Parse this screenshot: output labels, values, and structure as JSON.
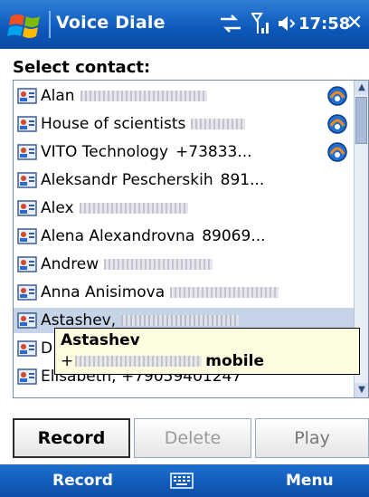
{
  "titlebar": {
    "title": "Voice Diale",
    "clock": "17:58",
    "close_glyph": "✕",
    "icons": [
      "windows-start-icon",
      "sync-icon",
      "signal-icon",
      "volume-icon"
    ]
  },
  "select_label": "Select contact:",
  "contacts": [
    {
      "name": "Alan",
      "number": "",
      "redacted_number": true,
      "voice_tag": true
    },
    {
      "name": "House of scientists",
      "number": "",
      "redacted_number": true,
      "voice_tag": true
    },
    {
      "name": "VITO Technology",
      "number": "+73833...",
      "redacted_number": false,
      "voice_tag": true
    },
    {
      "name": "Aleksandr Pescherskih",
      "number": "891...",
      "redacted_number": false,
      "voice_tag": false
    },
    {
      "name": "Alex",
      "number": "",
      "redacted_number": true,
      "voice_tag": false
    },
    {
      "name": "Alena Alexandrovna",
      "number": "89069...",
      "redacted_number": false,
      "voice_tag": false
    },
    {
      "name": "Andrew",
      "number": "",
      "redacted_number": true,
      "voice_tag": false
    },
    {
      "name": "Anna Anisimova",
      "number": "",
      "redacted_number": true,
      "voice_tag": false
    },
    {
      "name": "Astashev,",
      "number": "",
      "redacted_number": true,
      "voice_tag": false,
      "selected": true
    },
    {
      "name": "D",
      "number": "",
      "redacted_number": false,
      "voice_tag": false
    },
    {
      "name": "Elisabeth, +79059401247",
      "number": "",
      "redacted_number": false,
      "voice_tag": false
    }
  ],
  "tooltip": {
    "name": "Astashev",
    "number_prefix": "+",
    "number_type": "mobile"
  },
  "buttons": {
    "record": "Record",
    "delete": "Delete",
    "play": "Play"
  },
  "softkeys": {
    "left": "Record",
    "right": "Menu"
  },
  "colors": {
    "titlebar": "#0d57b8",
    "selection": "#c6d4e8",
    "tooltip_bg": "#fffde0",
    "disabled_text": "#9a9a9a"
  }
}
